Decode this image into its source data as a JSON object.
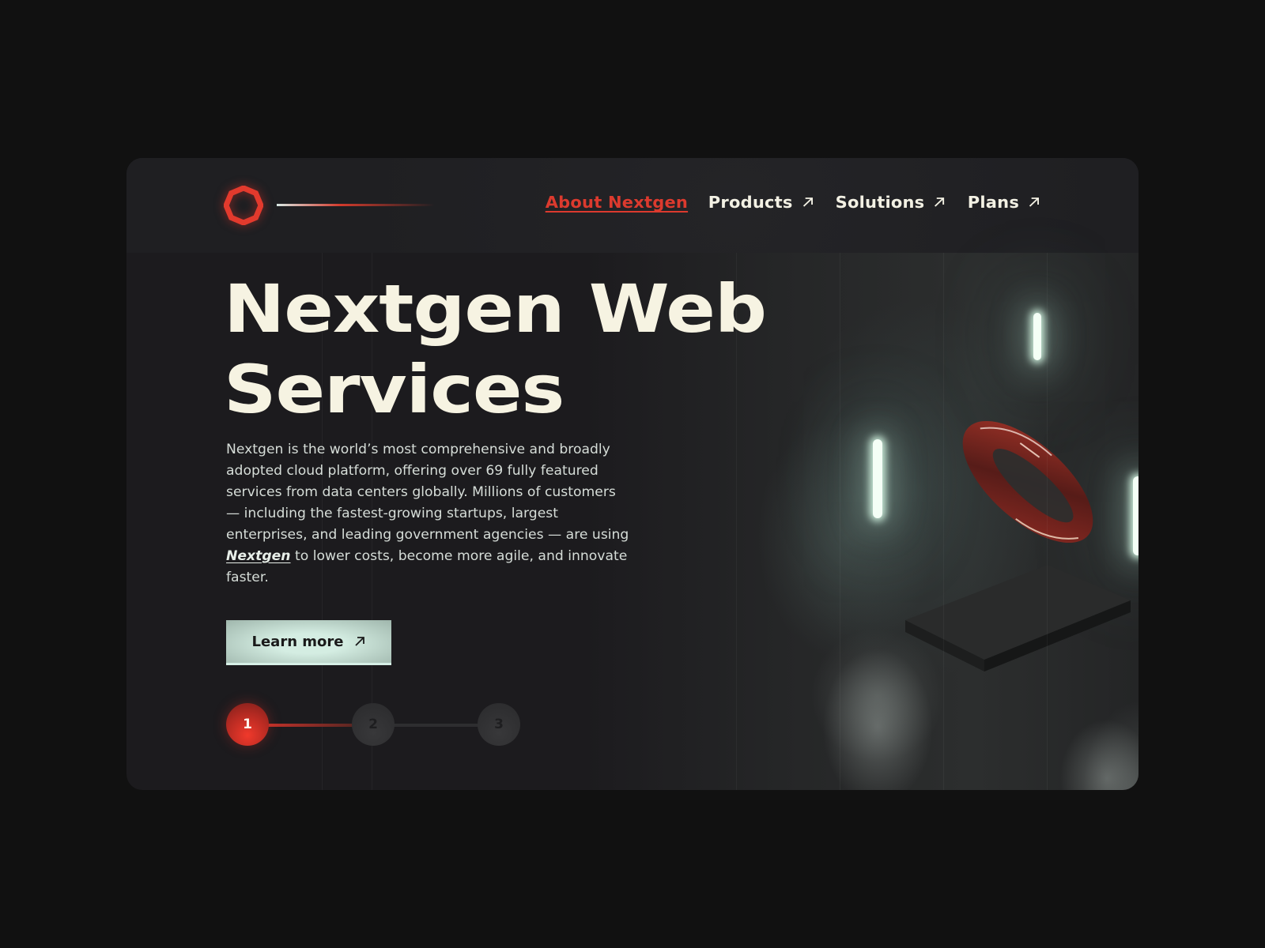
{
  "brand": {
    "name": "Nextgen",
    "logo_icon": "octagon-ring-icon",
    "accent_color": "#dc3a2e",
    "text_color": "#f6f3e2"
  },
  "nav": {
    "items": [
      {
        "label": "About Nextgen",
        "active": true,
        "external": false
      },
      {
        "label": "Products",
        "active": false,
        "external": true,
        "icon": "arrow-up-right-icon"
      },
      {
        "label": "Solutions",
        "active": false,
        "external": true,
        "icon": "arrow-up-right-icon"
      },
      {
        "label": "Plans",
        "active": false,
        "external": true,
        "icon": "arrow-up-right-icon"
      }
    ]
  },
  "hero": {
    "title_line1": "Nextgen Web",
    "title_line2": "Services",
    "description_before": "Nextgen is the world’s most comprehensive and broadly adopted cloud platform, offering over 69 fully featured services from data centers globally. Millions of customers — including the fastest-growing startups, largest enterprises, and leading government agencies — are using ",
    "description_link": "Nextgen",
    "description_after": " to lower costs, become more agile, and innovate faster.",
    "cta_label": "Learn more",
    "cta_icon": "arrow-up-right-icon",
    "illustration": "glass-torus-on-pedestal-with-light-bars"
  },
  "stepper": {
    "current": 1,
    "steps": [
      {
        "label": "1",
        "active": true
      },
      {
        "label": "2",
        "active": false
      },
      {
        "label": "3",
        "active": false
      }
    ]
  }
}
